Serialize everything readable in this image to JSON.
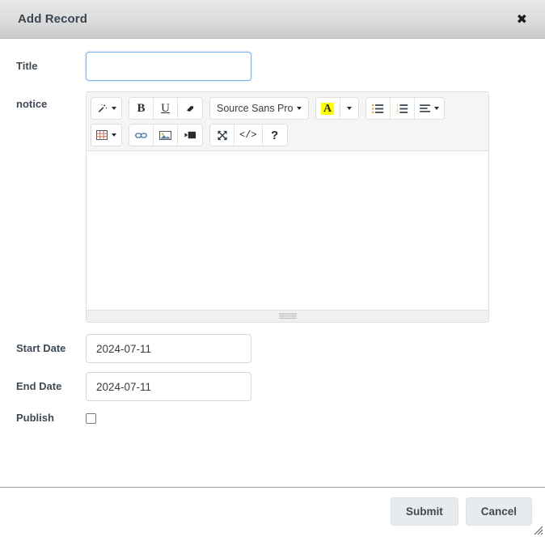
{
  "dialog": {
    "title": "Add Record",
    "close_icon": "close-icon"
  },
  "form": {
    "title_field": {
      "label": "Title",
      "value": "",
      "placeholder": ""
    },
    "notice_field": {
      "label": "notice",
      "value": ""
    },
    "start_date": {
      "label": "Start Date",
      "value": "2024-07-11"
    },
    "end_date": {
      "label": "End Date",
      "value": "2024-07-11"
    },
    "publish": {
      "label": "Publish",
      "checked": false
    }
  },
  "editor": {
    "toolbar_row1": [
      {
        "name": "magic-wand-icon",
        "glyph": "✦",
        "type": "dropdown",
        "group": 0
      },
      {
        "name": "bold-icon",
        "glyph": "B",
        "type": "button",
        "group": 1
      },
      {
        "name": "underline-icon",
        "glyph": "U",
        "type": "button",
        "group": 1
      },
      {
        "name": "eraser-icon",
        "glyph": "▰",
        "type": "button",
        "group": 1
      },
      {
        "name": "font-family-select",
        "glyph": "Source Sans Pro",
        "type": "dropdown",
        "group": 2
      },
      {
        "name": "text-highlight-icon",
        "glyph": "A",
        "type": "button",
        "group": 3
      },
      {
        "name": "text-color-dropdown",
        "glyph": "",
        "type": "dropdown",
        "group": 3
      },
      {
        "name": "unordered-list-icon",
        "glyph": "☰",
        "type": "button",
        "group": 4
      },
      {
        "name": "ordered-list-icon",
        "glyph": "☰",
        "type": "button",
        "group": 4
      },
      {
        "name": "align-dropdown-icon",
        "glyph": "☰",
        "type": "dropdown",
        "group": 4
      }
    ],
    "toolbar_row2": [
      {
        "name": "table-icon",
        "glyph": "▦",
        "type": "dropdown",
        "group": 0
      },
      {
        "name": "link-icon",
        "glyph": "⚭",
        "type": "button",
        "group": 1
      },
      {
        "name": "image-icon",
        "glyph": "ὛC",
        "type": "button",
        "group": 1
      },
      {
        "name": "video-icon",
        "glyph": "▶",
        "type": "button",
        "group": 1
      },
      {
        "name": "fullscreen-icon",
        "glyph": "⤢",
        "type": "button",
        "group": 2
      },
      {
        "name": "code-view-icon",
        "glyph": "</>",
        "type": "button",
        "group": 2
      },
      {
        "name": "help-icon",
        "glyph": "?",
        "type": "button",
        "group": 2
      }
    ],
    "font_name": "Source Sans Pro",
    "content": ""
  },
  "footer": {
    "submit_label": "Submit",
    "cancel_label": "Cancel"
  },
  "colors": {
    "header_bg": "#dcdcdc",
    "accent_focus": "#7db4ea",
    "highlight": "#ffff00",
    "label_text": "#3f4a55",
    "button_bg": "#e8ebed"
  }
}
